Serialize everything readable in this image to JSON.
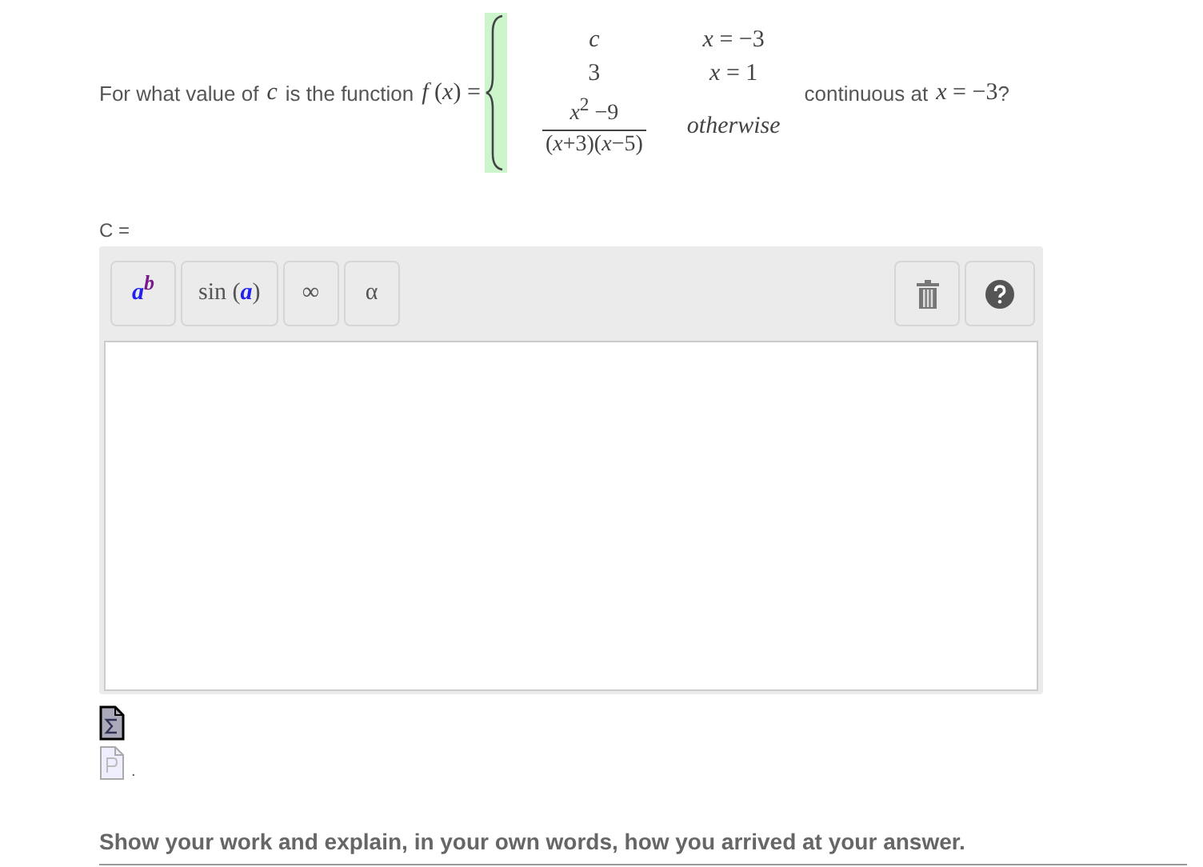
{
  "question": {
    "before": [
      {
        "kind": "text",
        "text": "For what value of"
      },
      {
        "kind": "math",
        "text": "*c*"
      },
      {
        "kind": "text",
        "text": "is the function"
      },
      {
        "kind": "math",
        "text": "*f* (*x*) ="
      }
    ],
    "cases": [
      {
        "kind": "plain",
        "value": "*c*",
        "condition": "*x* = −3"
      },
      {
        "kind": "plain",
        "value": "3",
        "condition": "*x* = 1"
      },
      {
        "kind": "fraction",
        "numerator": "*x*$^{2}$ −9",
        "denominator": "(*x*+3)(*x*−5)",
        "condition": "*otherwise*"
      }
    ],
    "after": [
      {
        "kind": "text",
        "text": "continuous at"
      },
      {
        "kind": "math",
        "text": "*x* = −3"
      },
      {
        "kind": "text",
        "text": "?"
      }
    ]
  },
  "answer_label": "C =",
  "editor": {
    "tools": [
      {
        "kind": "power",
        "base": "a",
        "sup": "b"
      },
      {
        "kind": "function",
        "name": "sin (",
        "arg": "a",
        "close": ")"
      },
      {
        "kind": "symbol",
        "text": "∞"
      },
      {
        "kind": "symbol",
        "text": "α"
      }
    ],
    "actions": [
      {
        "kind": "delete"
      },
      {
        "kind": "help"
      }
    ]
  },
  "attachments": [
    {
      "kind": "formula"
    },
    {
      "kind": "page",
      "suffix": "."
    }
  ],
  "instruction": "Show your work and explain, in your own words, how you arrived at your answer."
}
